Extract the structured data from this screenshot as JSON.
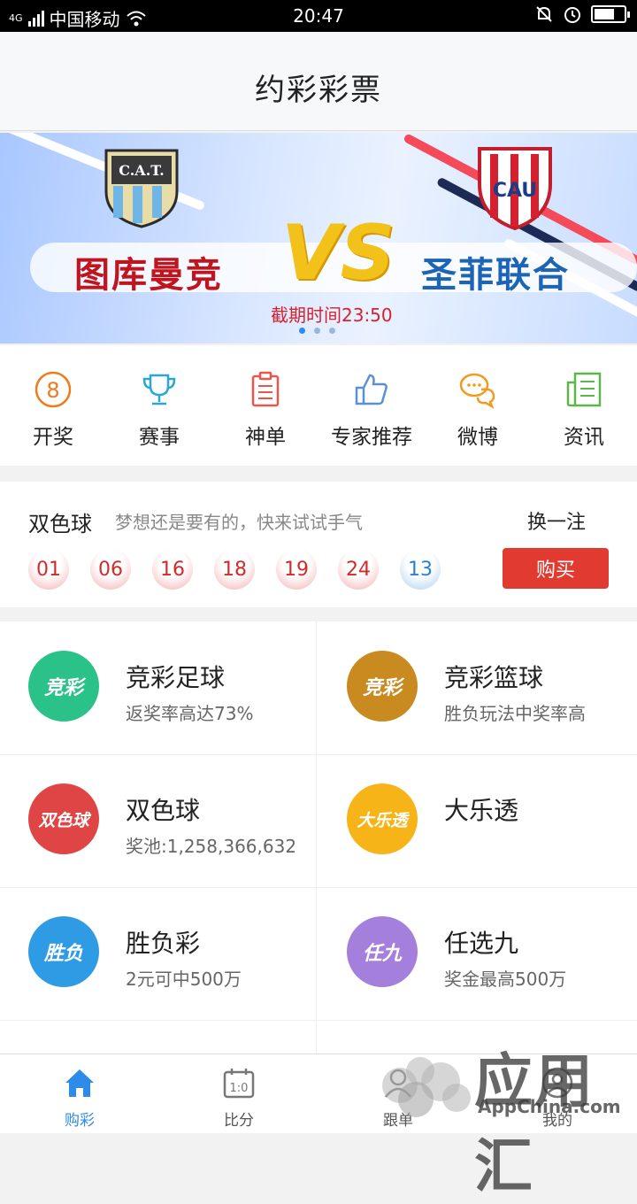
{
  "status": {
    "network": "4G",
    "carrier": "中国移动",
    "time": "20:47"
  },
  "header": {
    "title": "约彩彩票"
  },
  "banner": {
    "home_team": "图库曼竞",
    "away_team": "圣菲联合",
    "vs": "VS",
    "deadline": "截期时间23:50",
    "home_logo_text": "C.A.T.",
    "away_logo_text": "CAU"
  },
  "quick": [
    {
      "label": "开奖",
      "icon": "lottery-8-icon",
      "color": "#f07a1e"
    },
    {
      "label": "赛事",
      "icon": "trophy-icon",
      "color": "#2aa7d8"
    },
    {
      "label": "神单",
      "icon": "clipboard-icon",
      "color": "#e8574a"
    },
    {
      "label": "专家推荐",
      "icon": "thumbs-up-icon",
      "color": "#5d8fd8"
    },
    {
      "label": "微博",
      "icon": "chat-bubbles-icon",
      "color": "#f39a1e"
    },
    {
      "label": "资讯",
      "icon": "news-icon",
      "color": "#5bb848"
    }
  ],
  "lotto": {
    "name": "双色球",
    "slogan": "梦想还是要有的，快来试试手气",
    "change_label": "换一注",
    "red_balls": [
      "01",
      "06",
      "16",
      "18",
      "19",
      "24"
    ],
    "blue_ball": "13",
    "buy_label": "购买"
  },
  "games": [
    {
      "name": "竞彩足球",
      "sub": "返奖率高达73%",
      "icon_text": "竞彩",
      "color": "#2bc28a"
    },
    {
      "name": "竞彩篮球",
      "sub": "胜负玩法中奖率高",
      "icon_text": "竞彩",
      "color": "#c98a1f"
    },
    {
      "name": "双色球",
      "sub": "奖池:1,258,366,632",
      "icon_text": "双色球",
      "color": "#e04545"
    },
    {
      "name": "大乐透",
      "sub": "",
      "icon_text": "大乐透",
      "color": "#f6b418"
    },
    {
      "name": "胜负彩",
      "sub": "2元可中500万",
      "icon_text": "胜负",
      "color": "#2e9be4"
    },
    {
      "name": "任选九",
      "sub": "奖金最高500万",
      "icon_text": "任九",
      "color": "#a57fdc"
    }
  ],
  "tabs": [
    {
      "label": "购彩",
      "icon": "home-icon"
    },
    {
      "label": "比分",
      "icon": "score-calendar-icon"
    },
    {
      "label": "跟单",
      "icon": "follow-icon"
    },
    {
      "label": "我的",
      "icon": "profile-icon"
    }
  ],
  "watermark": {
    "text": "应用汇",
    "sub": "AppChina.com"
  }
}
